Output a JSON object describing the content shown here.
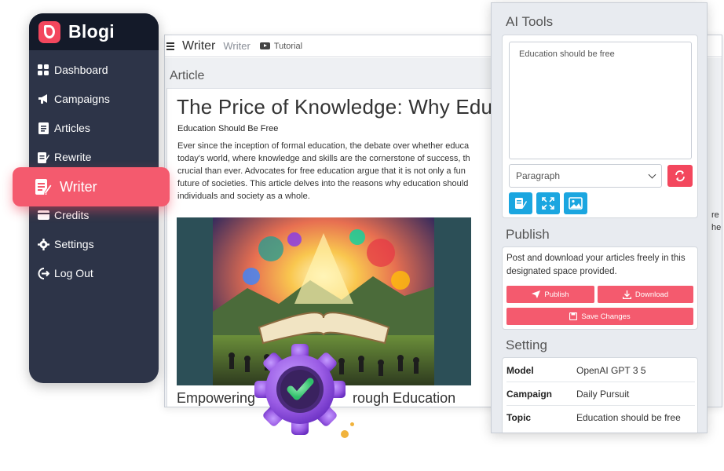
{
  "brand": {
    "name": "Blogi"
  },
  "sidebar": {
    "items": [
      {
        "label": "Dashboard",
        "icon": "dashboard-icon"
      },
      {
        "label": "Campaigns",
        "icon": "megaphone-icon"
      },
      {
        "label": "Articles",
        "icon": "article-icon"
      },
      {
        "label": "Rewrite",
        "icon": "rewrite-icon"
      },
      {
        "label": "Writer",
        "icon": "writer-icon",
        "active": true
      },
      {
        "label": "Credits",
        "icon": "credits-icon"
      },
      {
        "label": "Settings",
        "icon": "gear-icon"
      },
      {
        "label": "Log Out",
        "icon": "logout-icon"
      }
    ]
  },
  "editor": {
    "title": "Writer",
    "subtitle": "Writer",
    "tutorial_label": "Tutorial",
    "section_label": "Article",
    "article": {
      "title": "The Price of Knowledge: Why Edu",
      "subtitle": "Education Should Be Free",
      "paragraph_lines": [
        "Ever since the inception of formal education, the debate over whether educa",
        "today's world, where knowledge and skills are the cornerstone of success, th",
        "crucial than ever. Advocates for free education argue that it is not only a fun",
        "future of societies. This article delves into the reasons why education should",
        "individuals and society as a whole."
      ],
      "heading2": "Empowering",
      "heading2_tail": "rough Education",
      "overflow_fragments": [
        "re",
        "he"
      ]
    }
  },
  "ai_tools": {
    "title": "AI Tools",
    "prompt_value": "Education should be free",
    "format_select": "Paragraph",
    "tool_buttons": [
      "write-icon",
      "expand-icon",
      "image-icon"
    ]
  },
  "publish": {
    "title": "Publish",
    "description": "Post and download your articles freely in this designated space provided.",
    "publish_label": "Publish",
    "download_label": "Download",
    "save_label": "Save Changes"
  },
  "setting": {
    "title": "Setting",
    "rows": [
      {
        "key": "Model",
        "value": "OpenAI GPT 3 5"
      },
      {
        "key": "Campaign",
        "value": "Daily Pursuit"
      },
      {
        "key": "Topic",
        "value": "Education should be free"
      }
    ]
  },
  "colors": {
    "accent": "#f3475d",
    "sidebar_bg": "#2d3448",
    "sidebar_head": "#141a29",
    "tool_blue": "#1ba6e0",
    "gear_purple": "#9b5de5",
    "check_green": "#4fd17e"
  }
}
